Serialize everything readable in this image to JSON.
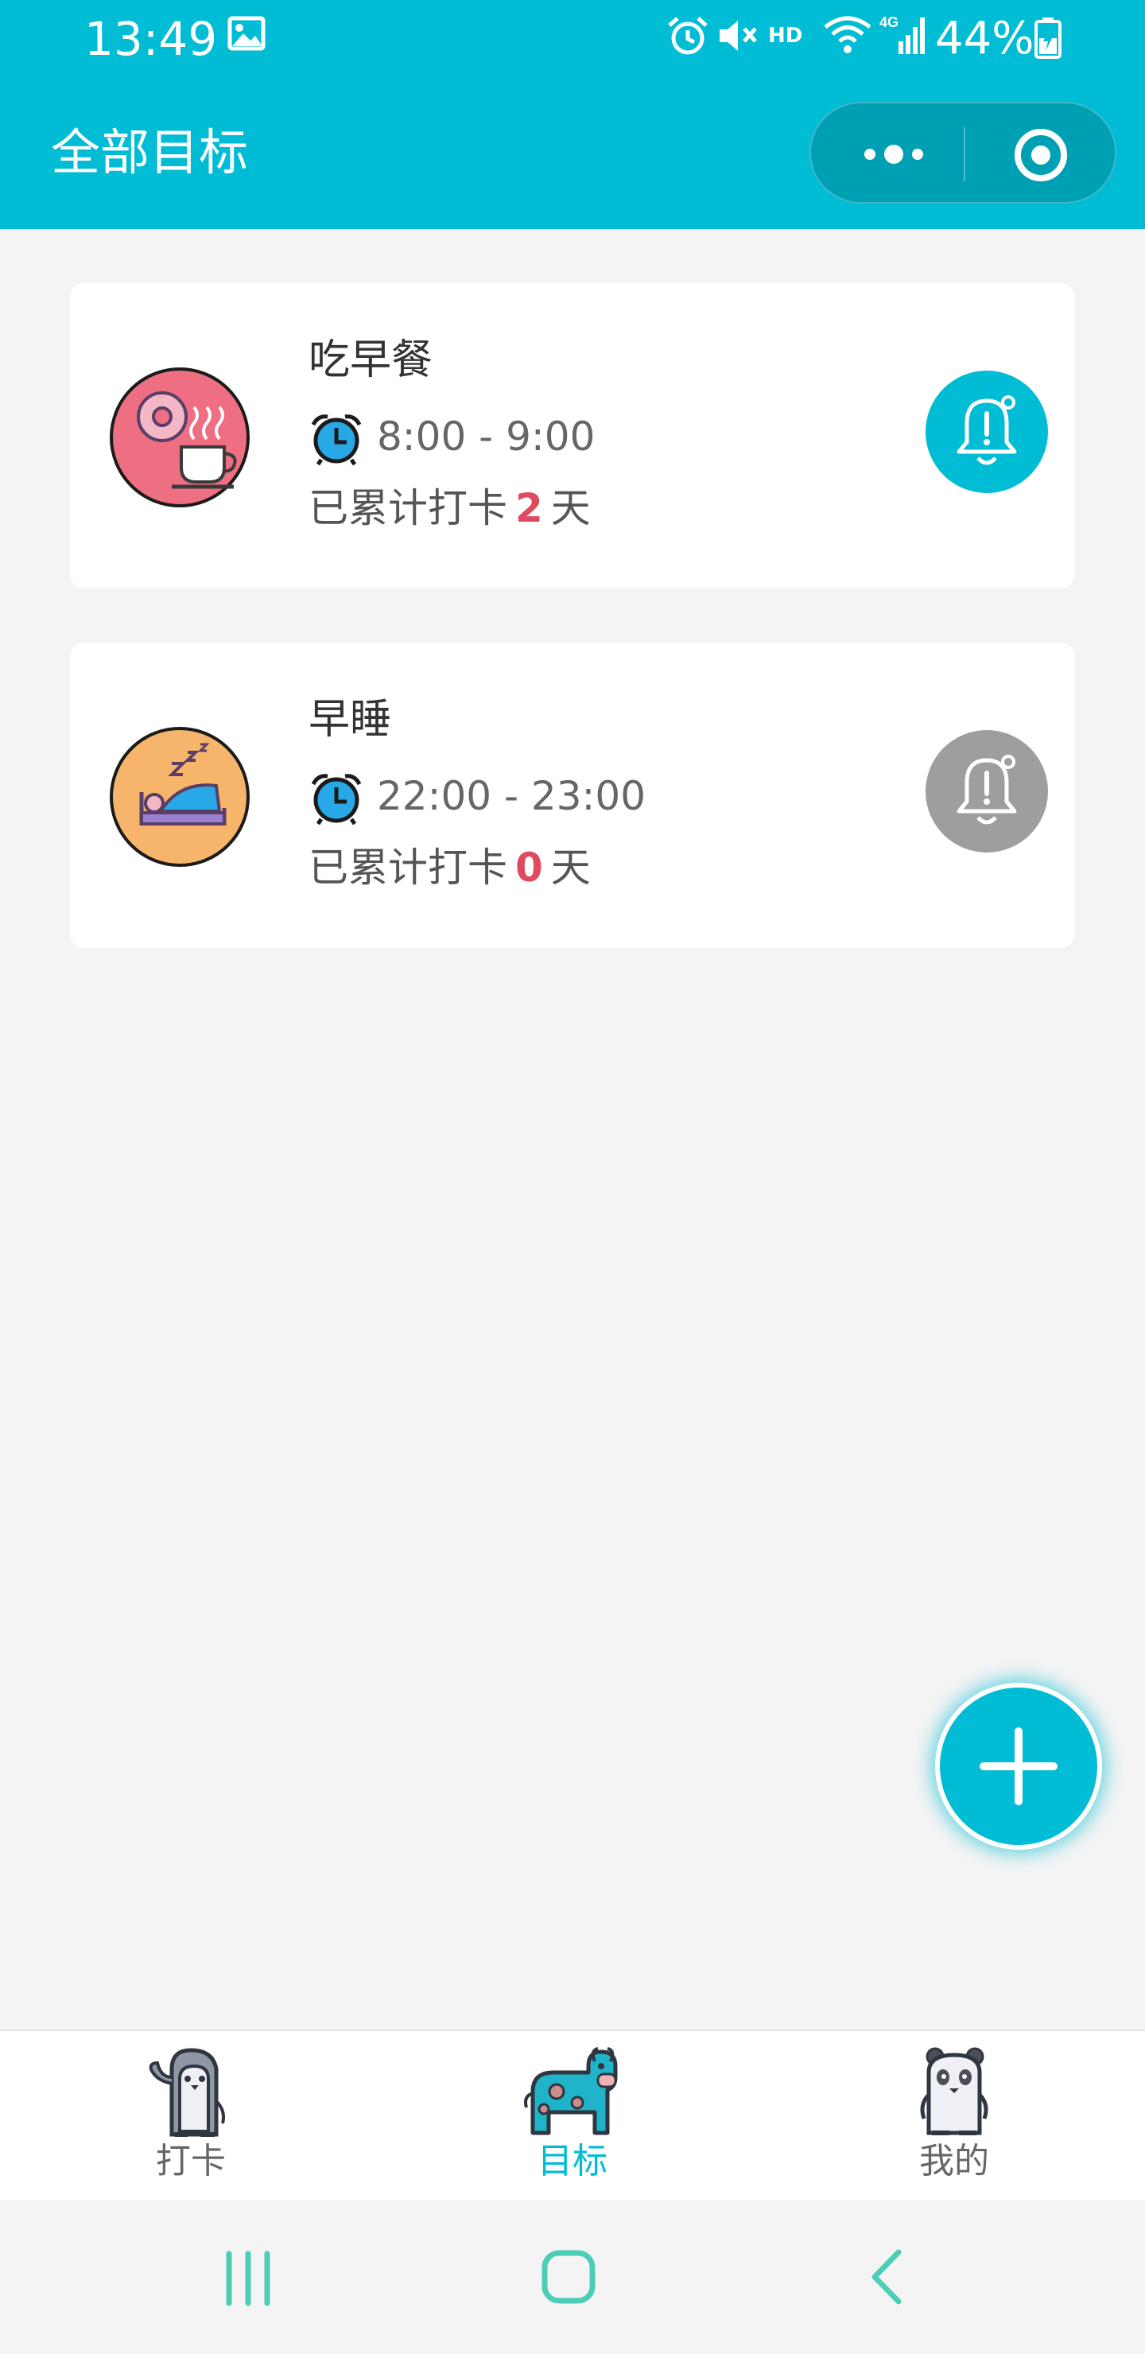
{
  "status_bar": {
    "time": "13:49",
    "hd_label": "HD",
    "network_label": "4G",
    "battery_percent": "44%",
    "icons": [
      "image-icon",
      "alarm-icon",
      "mute-icon",
      "wifi-icon",
      "signal-icon",
      "battery-icon"
    ]
  },
  "nav": {
    "title": "全部目标",
    "capsule_icons": [
      "more-dots-icon",
      "close-target-icon"
    ]
  },
  "goals": [
    {
      "name": "吃早餐",
      "time": "8:00 - 9:00",
      "count_prefix": "已累计打卡",
      "count": "2",
      "count_suffix": "天",
      "icon": "breakfast-icon",
      "reminder_enabled": true
    },
    {
      "name": "早睡",
      "time": "22:00 - 23:00",
      "count_prefix": "已累计打卡",
      "count": "0",
      "count_suffix": "天",
      "icon": "sleep-icon",
      "reminder_enabled": false
    }
  ],
  "fab": {
    "icon": "plus-icon"
  },
  "tabbar": {
    "tabs": [
      {
        "label": "打卡",
        "icon": "penguin-icon",
        "active": false
      },
      {
        "label": "目标",
        "icon": "cow-icon",
        "active": true
      },
      {
        "label": "我的",
        "icon": "panda-icon",
        "active": false
      }
    ]
  },
  "colors": {
    "primary": "#00bcd4",
    "background": "#f4f4f4",
    "card": "#ffffff",
    "count_highlight": "#e04a5f",
    "reminder_off": "#9e9e9e",
    "breakfast_bg": "#ef6f82",
    "sleep_bg": "#f7b56c",
    "system_nav": "#4ccdb8"
  }
}
